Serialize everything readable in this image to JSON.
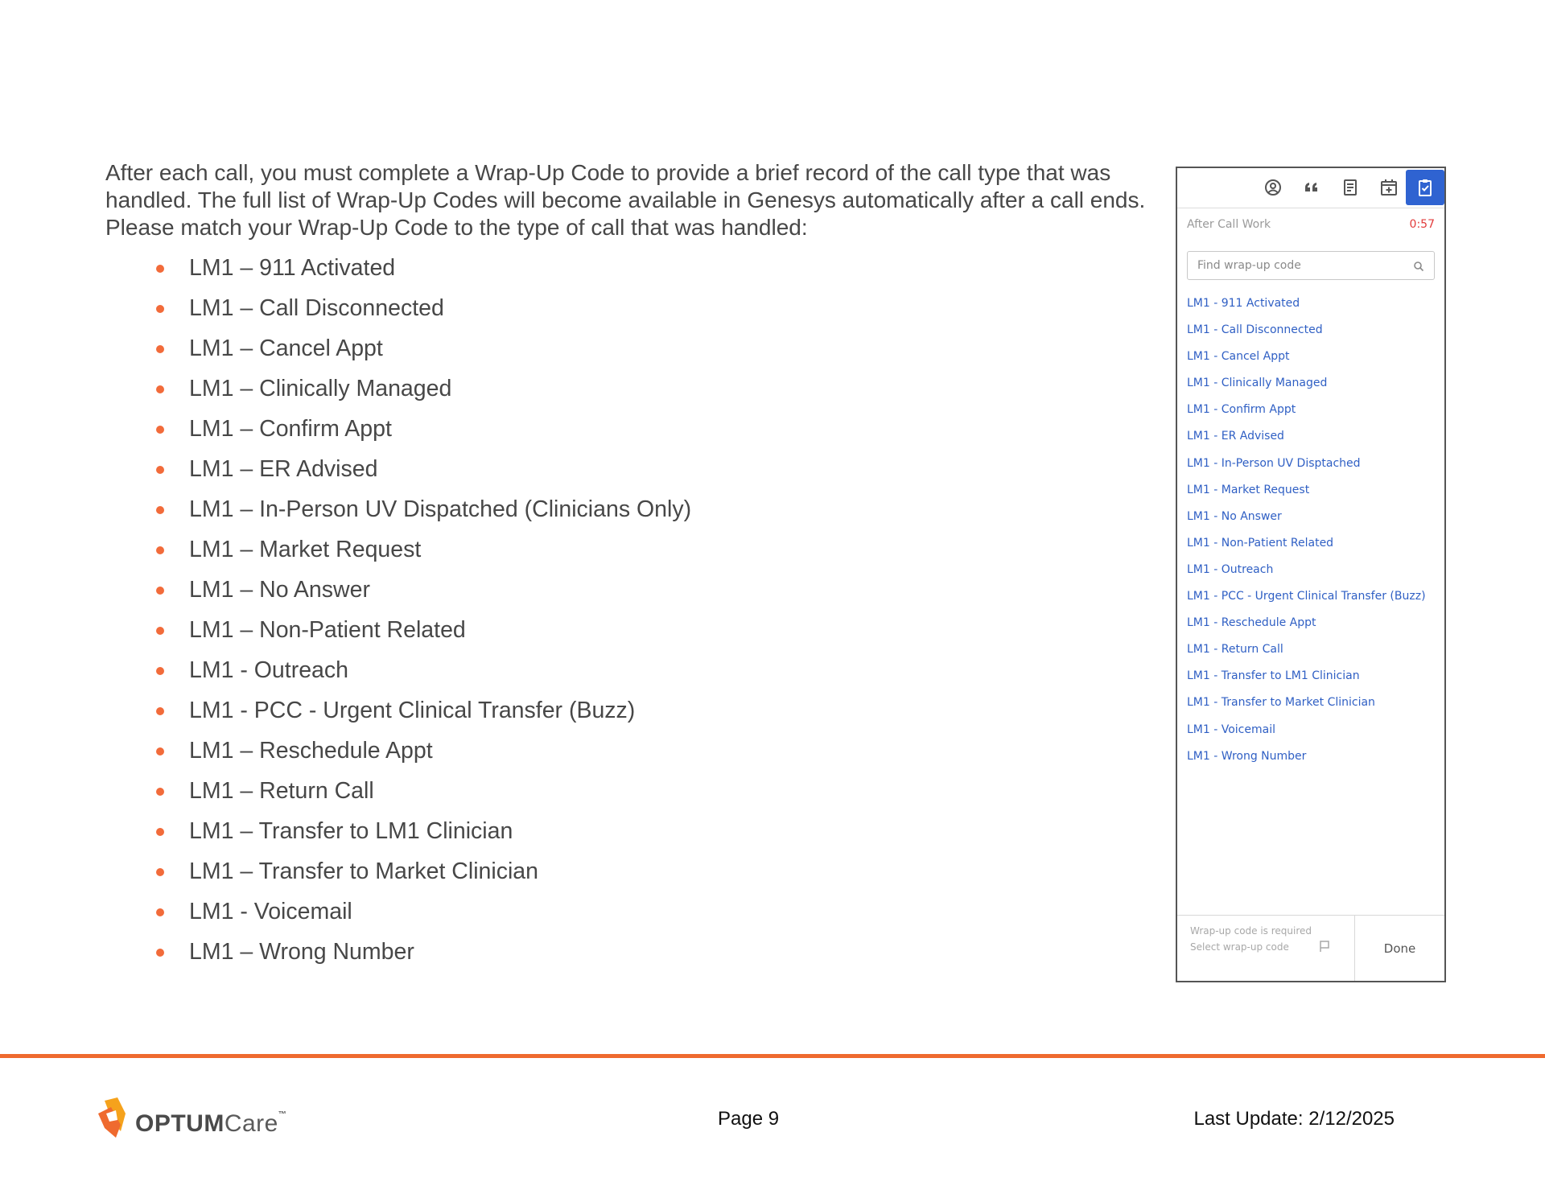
{
  "intro": "After each call, you must complete a Wrap-Up Code to provide a brief record of the call type that was handled. The full list of Wrap-Up Codes will become available in Genesys automatically after a call ends. Please match your Wrap-Up Code to the type of call that was handled:",
  "bullets": [
    "LM1 – 911 Activated",
    "LM1 – Call Disconnected",
    "LM1 – Cancel Appt",
    "LM1 – Clinically Managed",
    "LM1 – Confirm Appt",
    "LM1 – ER Advised",
    "LM1 – In-Person UV Dispatched (Clinicians Only)",
    "LM1 – Market Request",
    "LM1 – No Answer",
    "LM1 – Non-Patient Related",
    "LM1 - Outreach",
    "LM1 - PCC - Urgent Clinical Transfer (Buzz)",
    "LM1 – Reschedule Appt",
    "LM1 – Return Call",
    "LM1 – Transfer to LM1 Clinician",
    "LM1 – Transfer to Market Clinician",
    "LM1 - Voicemail",
    "LM1 – Wrong Number"
  ],
  "panel": {
    "toolbar_icons": [
      "person-circle-icon",
      "quote-icon",
      "document-icon",
      "calendar-plus-icon",
      "clipboard-check-icon"
    ],
    "active_icon": "clipboard-check-icon",
    "title": "After Call Work",
    "timer": "0:57",
    "search_placeholder": "Find wrap-up code",
    "codes": [
      "LM1 - 911 Activated",
      "LM1 - Call Disconnected",
      "LM1 - Cancel Appt",
      "LM1 - Clinically Managed",
      "LM1 - Confirm Appt",
      "LM1 - ER Advised",
      "LM1 - In-Person UV Disptached",
      "LM1 - Market Request",
      "LM1 - No Answer",
      "LM1 - Non-Patient Related",
      "LM1 - Outreach",
      "LM1 - PCC - Urgent Clinical Transfer (Buzz)",
      "LM1 - Reschedule Appt",
      "LM1 - Return Call",
      "LM1 - Transfer to LM1 Clinician",
      "LM1 - Transfer to Market Clinician",
      "LM1 - Voicemail",
      "LM1 - Wrong Number"
    ],
    "required_text": "Wrap-up code is required",
    "select_text": "Select wrap-up code",
    "done_label": "Done"
  },
  "footer": {
    "logo_text": "OPTUM",
    "logo_care": "Care",
    "logo_tm": "™",
    "page": "Page 9",
    "last_update": "Last Update: 2/12/2025"
  },
  "colors": {
    "accent": "#ef6a2f",
    "bullet": "#f26b3a",
    "link": "#2f5fc4",
    "active_tool": "#2f63d1",
    "timer": "#e23b3b"
  }
}
